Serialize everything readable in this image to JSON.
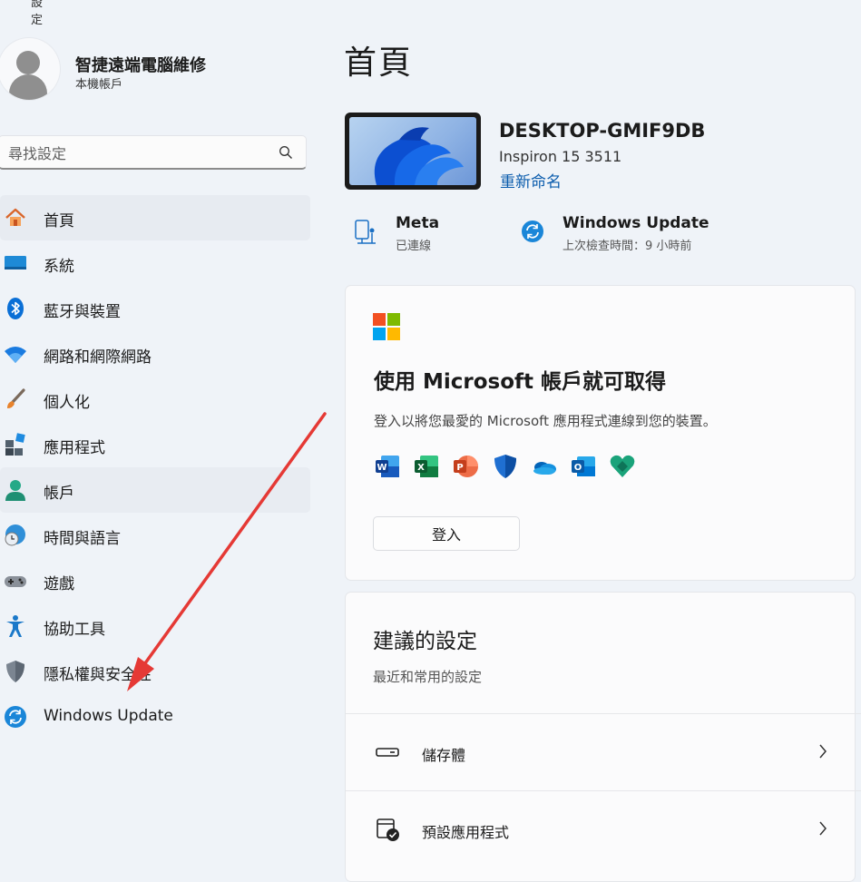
{
  "window": {
    "title": "設定",
    "back_label": "←"
  },
  "profile": {
    "name": "智捷遠端電腦維修",
    "account_type": "本機帳戶"
  },
  "search": {
    "placeholder": "尋找設定"
  },
  "nav": [
    {
      "label": "首頁",
      "icon": "home-icon"
    },
    {
      "label": "系統",
      "icon": "system-icon"
    },
    {
      "label": "藍牙與裝置",
      "icon": "bluetooth-icon"
    },
    {
      "label": "網路和網際網路",
      "icon": "wifi-icon"
    },
    {
      "label": "個人化",
      "icon": "brush-icon"
    },
    {
      "label": "應用程式",
      "icon": "apps-icon"
    },
    {
      "label": "帳戶",
      "icon": "account-icon"
    },
    {
      "label": "時間與語言",
      "icon": "time-language-icon"
    },
    {
      "label": "遊戲",
      "icon": "gamepad-icon"
    },
    {
      "label": "協助工具",
      "icon": "accessibility-icon"
    },
    {
      "label": "隱私權與安全性",
      "icon": "shield-icon"
    },
    {
      "label": "Windows Update",
      "icon": "update-icon"
    }
  ],
  "main": {
    "title": "首頁",
    "device": {
      "name": "DESKTOP-GMIF9DB",
      "model": "Inspiron 15 3511",
      "rename_label": "重新命名"
    },
    "network": {
      "title": "Meta",
      "status": "已連線"
    },
    "update": {
      "title": "Windows Update",
      "status": "上次檢查時間：9 小時前"
    },
    "ms_card": {
      "title": "使用 Microsoft 帳戶就可取得",
      "description": "登入以將您最愛的 Microsoft 應用程式連線到您的裝置。",
      "apps": [
        "word-icon",
        "excel-icon",
        "powerpoint-icon",
        "defender-icon",
        "onedrive-icon",
        "outlook-icon",
        "family-icon"
      ],
      "signin_label": "登入"
    },
    "suggested": {
      "title": "建議的設定",
      "subtitle": "最近和常用的設定",
      "items": [
        {
          "label": "儲存體",
          "icon": "storage-icon"
        },
        {
          "label": "預設應用程式",
          "icon": "default-apps-icon"
        }
      ]
    }
  },
  "colors": {
    "background": "#eff3f8",
    "accent": "#0b5cad",
    "annotation_arrow": "#e53935"
  }
}
